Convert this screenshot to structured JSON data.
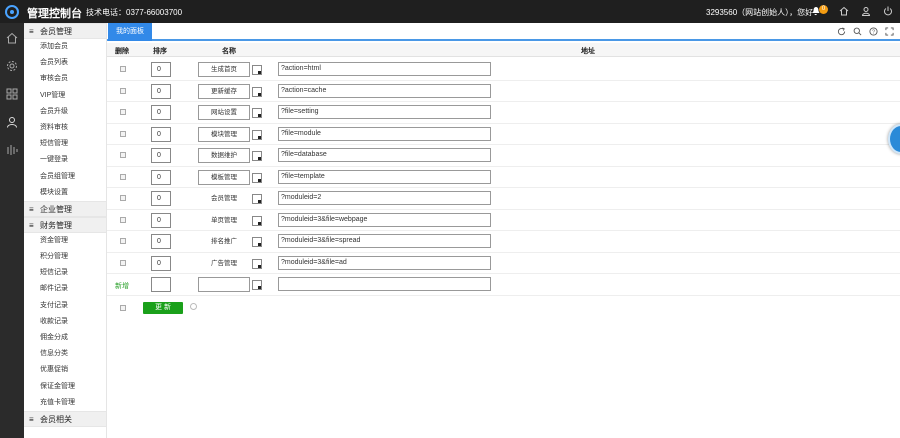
{
  "header": {
    "title": "管理控制台",
    "hotline": "技术电话：0377-66003700",
    "user": "3293560（网站创始人），您好！",
    "notification_count": "0",
    "icons": [
      "bell-icon",
      "home-icon",
      "user-icon",
      "power-icon"
    ]
  },
  "rail": {
    "icons": [
      "home-icon",
      "settings-icon",
      "grid-icon",
      "user-icon",
      "chart-icon"
    ]
  },
  "sidebar": {
    "sections": [
      {
        "title": "会员管理",
        "items": [
          "添加会员",
          "会员列表",
          "审核会员",
          "VIP管理",
          "会员升级",
          "资料审核",
          "短信管理",
          "一键登录",
          "会员组管理",
          "模块设置"
        ]
      },
      {
        "title": "企业管理",
        "items": []
      },
      {
        "title": "财务管理",
        "items": [
          "资金管理",
          "积分管理",
          "短信记录",
          "邮件记录",
          "支付记录",
          "收款记录",
          "佣金分成",
          "信息分类",
          "优惠促销",
          "保证金管理",
          "充值卡管理"
        ]
      },
      {
        "title": "会员相关",
        "items": []
      }
    ]
  },
  "main": {
    "tab": "我的面板",
    "tools": [
      "refresh-icon",
      "search-icon",
      "help-icon",
      "fullscreen-icon"
    ],
    "columns": {
      "delete": "删除",
      "order": "排序",
      "name": "名称",
      "address": "地址"
    },
    "rows": [
      {
        "order": "0",
        "name": "生成首页",
        "address": "?action=html",
        "bordered": true
      },
      {
        "order": "0",
        "name": "更新缓存",
        "address": "?action=cache",
        "bordered": true
      },
      {
        "order": "0",
        "name": "网站设置",
        "address": "?file=setting",
        "bordered": true
      },
      {
        "order": "0",
        "name": "模块管理",
        "address": "?file=module",
        "bordered": true
      },
      {
        "order": "0",
        "name": "数据维护",
        "address": "?file=database",
        "bordered": true
      },
      {
        "order": "0",
        "name": "模板管理",
        "address": "?file=template",
        "bordered": true
      },
      {
        "order": "0",
        "name": "会员管理",
        "address": "?moduleid=2",
        "bordered": false
      },
      {
        "order": "0",
        "name": "单页管理",
        "address": "?moduleid=3&file=webpage",
        "bordered": false
      },
      {
        "order": "0",
        "name": "排名推广",
        "address": "?moduleid=3&file=spread",
        "bordered": false
      },
      {
        "order": "0",
        "name": "广告管理",
        "address": "?moduleid=3&file=ad",
        "bordered": false
      }
    ],
    "add_label": "新增",
    "add_row": {
      "order": "",
      "name": "",
      "address": ""
    },
    "update_button": "更 新"
  }
}
